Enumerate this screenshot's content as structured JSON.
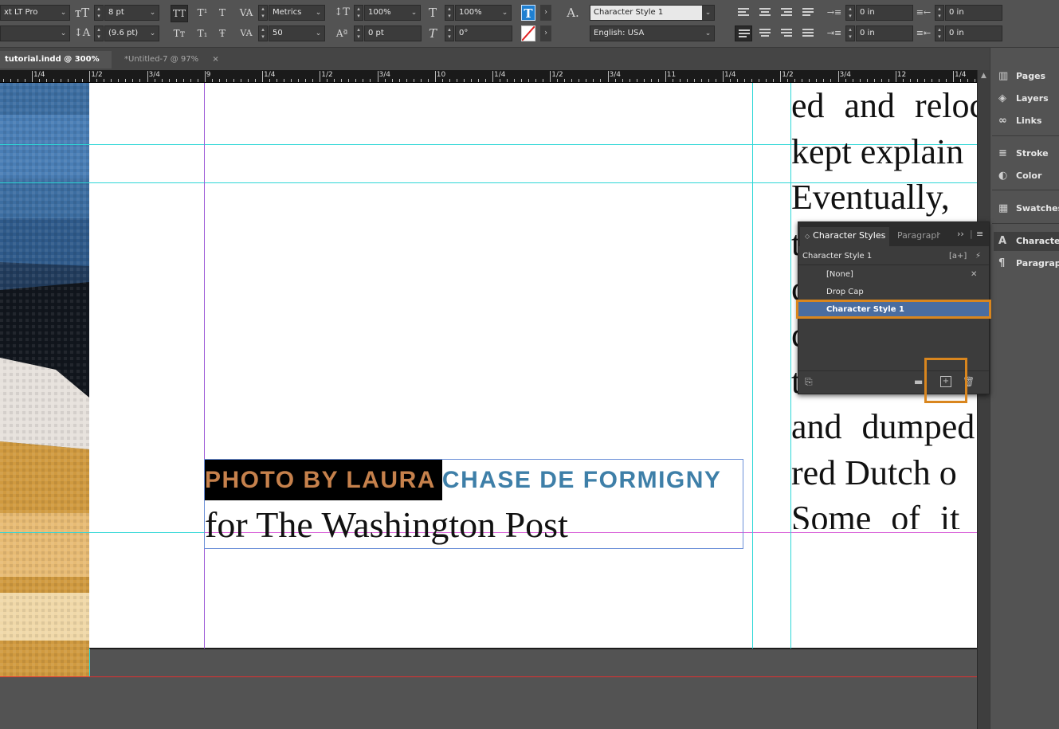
{
  "control_bar": {
    "font_family": "xt LT Pro",
    "font_style": "",
    "font_size": "8 pt",
    "leading": "(9.6 pt)",
    "kerning": "Metrics",
    "tracking": "50",
    "vertical_scale": "100%",
    "horizontal_scale": "100%",
    "baseline_shift": "0 pt",
    "skew": "0°",
    "character_style": "Character Style 1",
    "language": "English: USA",
    "left_indent": "0 in",
    "right_indent": "0 in",
    "first_line_indent": "0 in",
    "last_line_indent": "0 in"
  },
  "tabs": [
    {
      "label": "tutorial.indd @ 300%",
      "close": "×"
    },
    {
      "label": "*Untitled-7 @ 97%",
      "close": "×"
    }
  ],
  "ruler": {
    "labels": [
      "1/4",
      "1/2",
      "3/4",
      "9",
      "1/4",
      "1/2",
      "3/4",
      "10",
      "1/4",
      "1/2",
      "3/4",
      "11",
      "1/4",
      "1/2",
      "3/4",
      "12",
      "1/4"
    ]
  },
  "caption": {
    "highlighted": "PHOTO BY LAURA",
    "rest": "CHASE DE FORMIGNY",
    "line2": "for The Washington Post"
  },
  "body_text": {
    "lines": [
      "ed and reloc",
      "kept explain",
      "Eventually,",
      "t",
      "c",
      "c",
      "t",
      "and dumped",
      "red Dutch o",
      "Some of it i"
    ]
  },
  "dock": {
    "items": [
      {
        "label": "Pages",
        "icon": "pages-icon"
      },
      {
        "label": "Layers",
        "icon": "layers-icon"
      },
      {
        "label": "Links",
        "icon": "links-icon"
      },
      {
        "label": "Stroke",
        "icon": "stroke-icon"
      },
      {
        "label": "Color",
        "icon": "color-icon"
      },
      {
        "label": "Swatches",
        "icon": "swatches-icon"
      },
      {
        "label": "Character",
        "icon": "character-styles-icon"
      },
      {
        "label": "Paragraph",
        "icon": "paragraph-styles-icon"
      }
    ]
  },
  "character_styles_panel": {
    "tab_active": "Character Styles",
    "tab_inactive": "Paragraph",
    "current_style": "Character Style 1",
    "styles": [
      "[None]",
      "Drop Cap",
      "Character Style 1"
    ],
    "selected_index": 2
  },
  "colors": {
    "highlight_orange": "#d9861e",
    "caption_orange": "#c6814c",
    "caption_blue": "#3e7fa8",
    "selection_blue": "#4a6da0",
    "guide_cyan": "#2ed7d7"
  }
}
